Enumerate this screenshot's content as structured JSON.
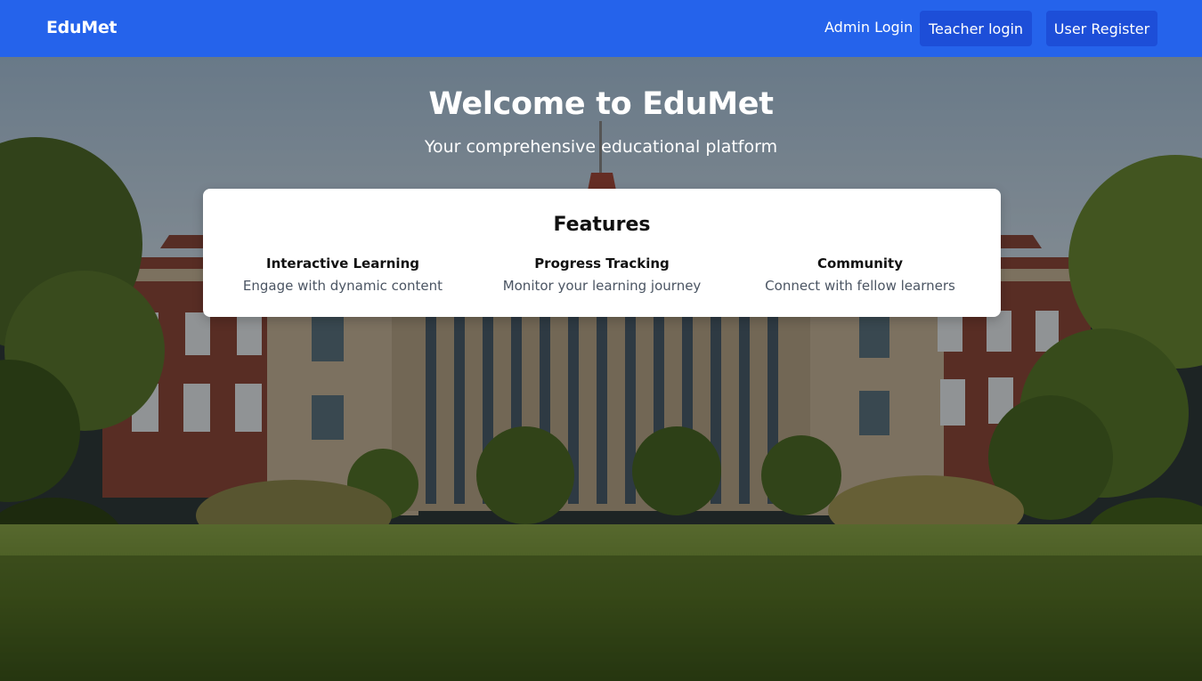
{
  "navbar": {
    "brand": "EduMet",
    "admin_login": "Admin Login",
    "teacher_login": "Teacher login",
    "user_register": "User Register"
  },
  "hero": {
    "title": "Welcome to EduMet",
    "subtitle": "Your comprehensive educational platform",
    "background": "university-building-photo"
  },
  "features": {
    "heading": "Features",
    "items": [
      {
        "title": "Interactive Learning",
        "description": "Engage with dynamic content"
      },
      {
        "title": "Progress Tracking",
        "description": "Monitor your learning journey"
      },
      {
        "title": "Community",
        "description": "Connect with fellow learners"
      }
    ]
  },
  "colors": {
    "navbar": "#2563eb",
    "nav_button": "#1d4ed8",
    "card": "#ffffff"
  }
}
